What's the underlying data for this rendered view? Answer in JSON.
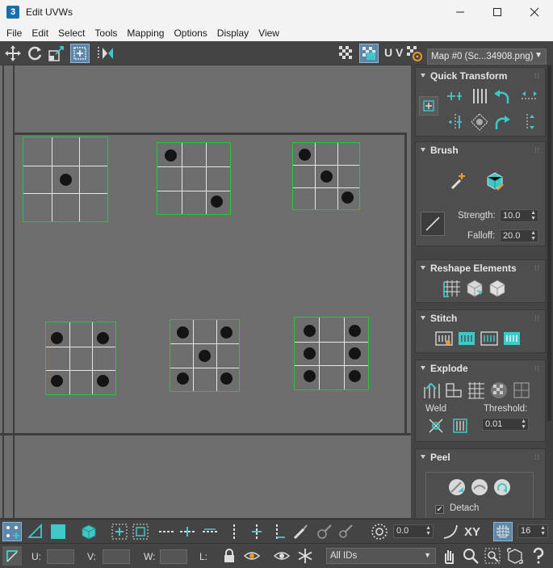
{
  "window": {
    "app_icon": "3",
    "title": "Edit UVWs"
  },
  "menu": [
    "File",
    "Edit",
    "Select",
    "Tools",
    "Mapping",
    "Options",
    "Display",
    "View"
  ],
  "toolbar": {
    "uv_label": "U V",
    "map_select": "Map #0 (Sc...34908.png)"
  },
  "viewport": {
    "uv_elements": [
      {
        "dots": [
          [
            0.5,
            0.5
          ]
        ]
      },
      {
        "dots": [
          [
            0.18,
            0.18
          ],
          [
            0.82,
            0.82
          ]
        ]
      },
      {
        "dots": [
          [
            0.18,
            0.18
          ],
          [
            0.5,
            0.5
          ],
          [
            0.82,
            0.82
          ]
        ]
      },
      {
        "dots": [
          [
            0.16,
            0.22
          ],
          [
            0.82,
            0.22
          ],
          [
            0.16,
            0.82
          ],
          [
            0.82,
            0.82
          ]
        ]
      },
      {
        "dots": [
          [
            0.18,
            0.18
          ],
          [
            0.82,
            0.18
          ],
          [
            0.5,
            0.5
          ],
          [
            0.18,
            0.82
          ],
          [
            0.82,
            0.82
          ]
        ]
      },
      {
        "dots": [
          [
            0.2,
            0.18
          ],
          [
            0.82,
            0.18
          ],
          [
            0.2,
            0.5
          ],
          [
            0.82,
            0.5
          ],
          [
            0.2,
            0.82
          ],
          [
            0.82,
            0.82
          ]
        ]
      }
    ]
  },
  "panel": {
    "quick_transform": {
      "title": "Quick Transform"
    },
    "brush": {
      "title": "Brush",
      "strength_label": "Strength:",
      "strength_value": "10.0",
      "falloff_label": "Falloff:",
      "falloff_value": "20.0"
    },
    "reshape": {
      "title": "Reshape Elements"
    },
    "stitch": {
      "title": "Stitch"
    },
    "explode": {
      "title": "Explode",
      "weld_label": "Weld",
      "threshold_label": "Threshold:",
      "threshold_value": "0.01"
    },
    "peel": {
      "title": "Peel",
      "detach_label": "Detach",
      "detach_checked": "✔"
    }
  },
  "bottom": {
    "angle_value": "0.0",
    "xy_label": "XY",
    "grid_value": "16",
    "u_label": "U:",
    "v_label": "V:",
    "w_label": "W:",
    "l_label": "L:",
    "ids_select": "All IDs"
  },
  "colors": {
    "accent": "#3ec8c8",
    "uv_border": "#27c53e",
    "active_button": "#5d86a8"
  }
}
